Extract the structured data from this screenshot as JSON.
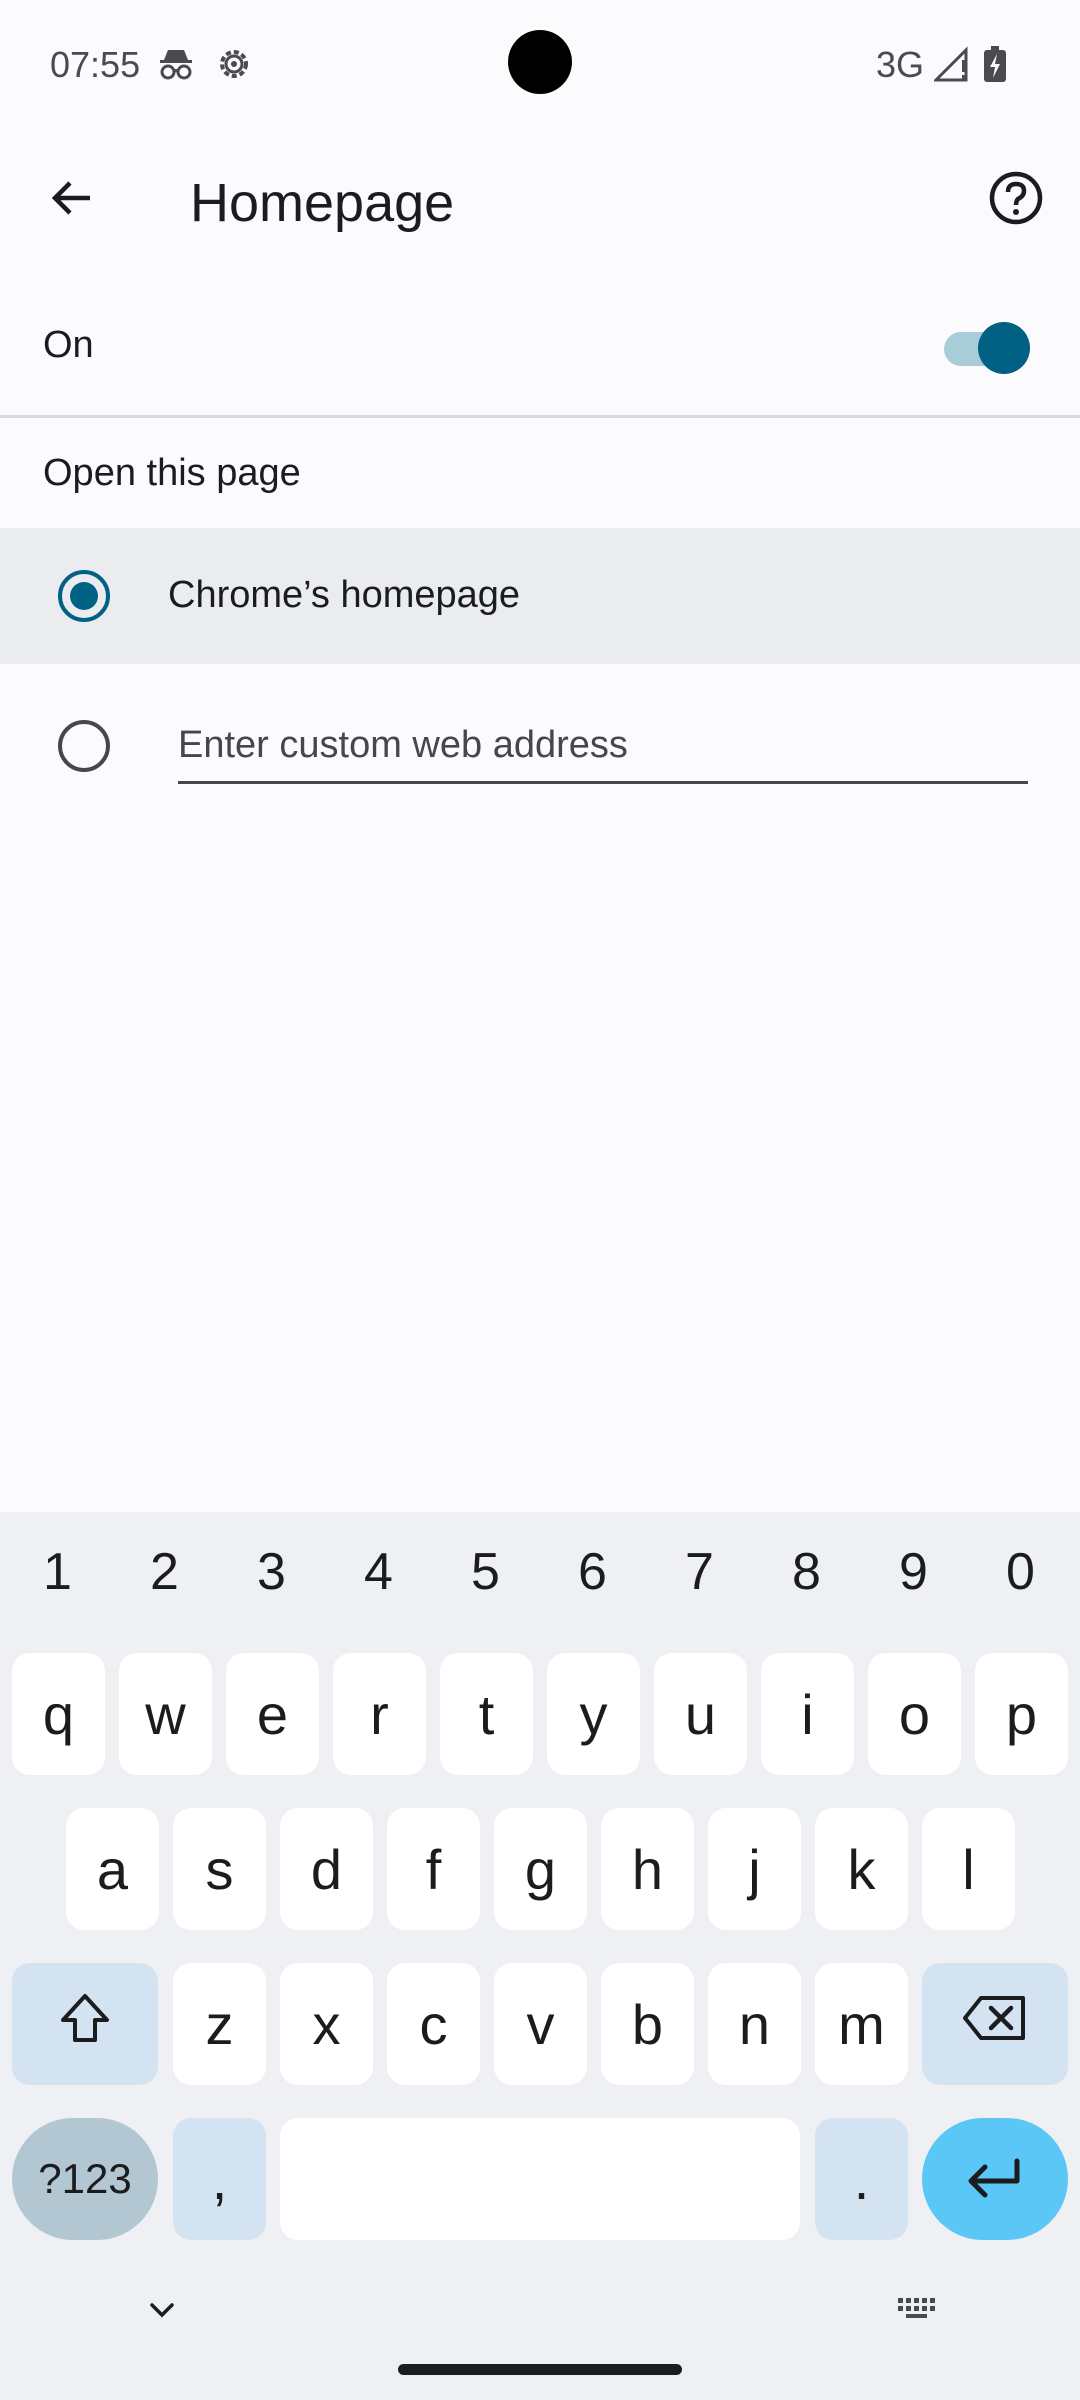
{
  "status_bar": {
    "time": "07:55",
    "left_icons": [
      "incognito-icon",
      "settings-gear-icon"
    ],
    "network": "3G",
    "right_icons": [
      "signal-icon",
      "battery-charging-icon"
    ]
  },
  "app_bar": {
    "title": "Homepage",
    "back_icon": "arrow-back-icon",
    "help_icon": "help-circle-icon"
  },
  "toggle": {
    "label": "On",
    "state": true,
    "accent": "#006185"
  },
  "section": {
    "label": "Open this page"
  },
  "options": [
    {
      "label": "Chrome’s homepage",
      "selected": true
    },
    {
      "placeholder": "Enter custom web address",
      "value": "",
      "selected": false
    }
  ],
  "keyboard": {
    "numbers": [
      "1",
      "2",
      "3",
      "4",
      "5",
      "6",
      "7",
      "8",
      "9",
      "0"
    ],
    "row1": [
      "q",
      "w",
      "e",
      "r",
      "t",
      "y",
      "u",
      "i",
      "o",
      "p"
    ],
    "row2": [
      "a",
      "s",
      "d",
      "f",
      "g",
      "h",
      "j",
      "k",
      "l"
    ],
    "row3": [
      "z",
      "x",
      "c",
      "v",
      "b",
      "n",
      "m"
    ],
    "symbols_label": "?123",
    "comma": ",",
    "period": ".",
    "shift_icon": "shift-icon",
    "backspace_icon": "backspace-icon",
    "enter_icon": "enter-arrow-icon",
    "hide_icon": "chevron-down-icon",
    "switch_keyboard_icon": "keyboard-icon"
  }
}
